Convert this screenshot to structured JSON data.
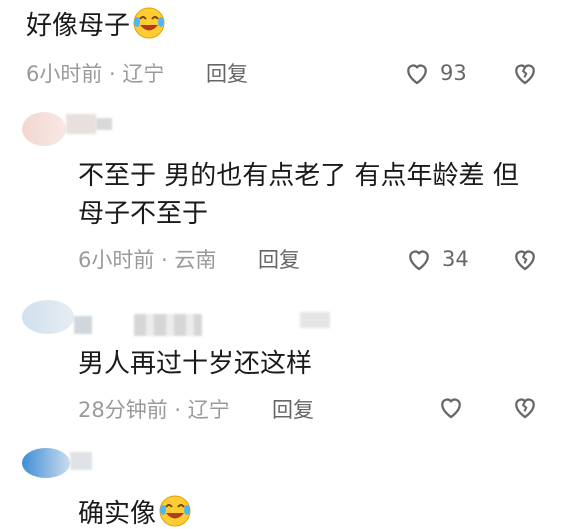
{
  "comments": [
    {
      "text": "好像母子",
      "time": "6小时前 · 辽宁",
      "reply": "回复",
      "likes": "93"
    },
    {
      "text_line1": "不至于 男的也有点老了 有点年龄差 但",
      "text_line2": "母子不至于",
      "time": "6小时前 · 云南",
      "reply": "回复",
      "likes": "34"
    },
    {
      "text": "男人再过十岁还这样",
      "time": "28分钟前 · 辽宁",
      "reply": "回复",
      "likes": ""
    },
    {
      "text": "确实像"
    }
  ],
  "icons": {
    "like": "heart-outline-icon",
    "dislike": "broken-heart-icon",
    "emoji": "laughing-crying-emoji-icon"
  },
  "colors": {
    "text": "#1a1a1a",
    "meta": "#9a9a9a",
    "icon": "#666666"
  }
}
